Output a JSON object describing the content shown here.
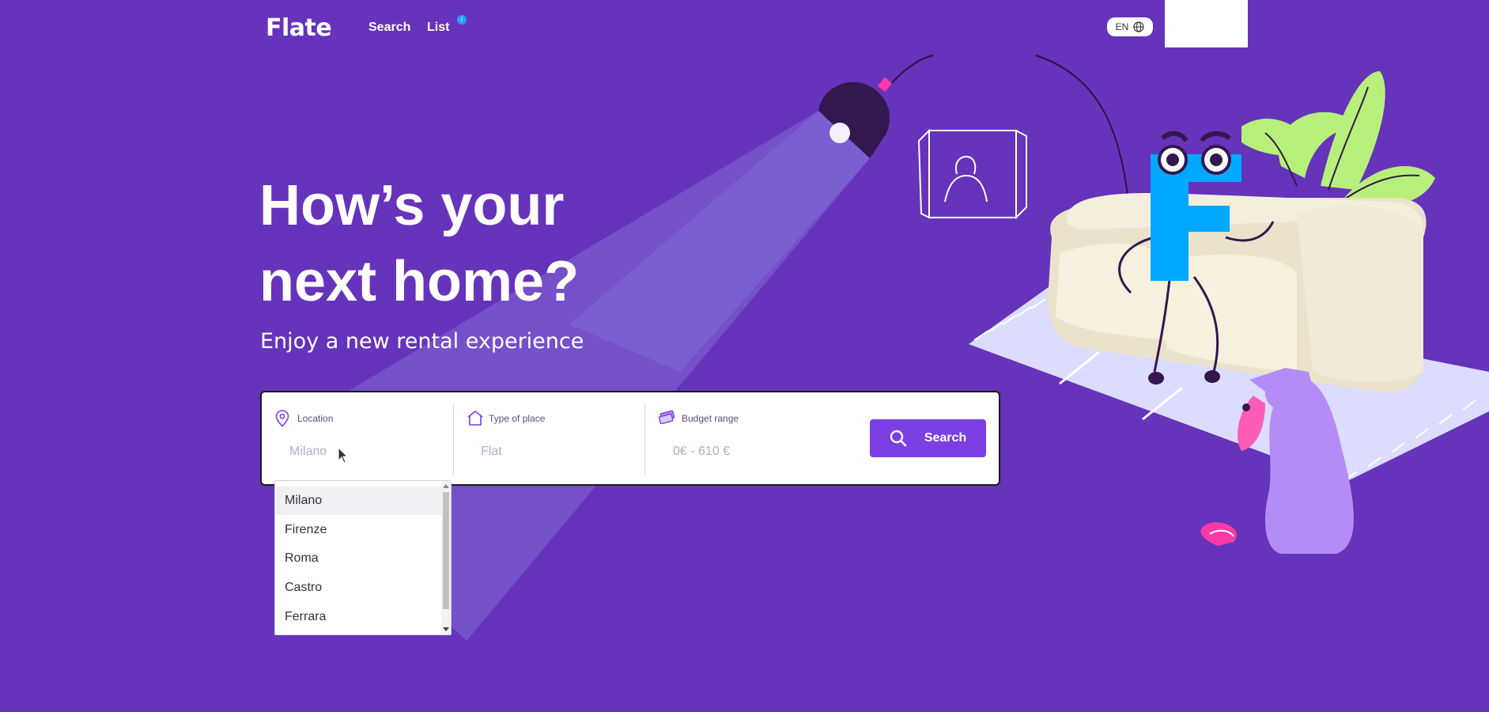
{
  "header": {
    "logo": "Flate",
    "nav": [
      {
        "label": "Search"
      },
      {
        "label": "List"
      }
    ],
    "info_badge": "i",
    "language": "EN"
  },
  "hero": {
    "title_line1": "How’s your",
    "title_line2": "next home?",
    "subtitle": "Enjoy a new rental experience"
  },
  "search": {
    "location": {
      "label": "Location",
      "value": "Milano",
      "icon": "location-pin-icon"
    },
    "type": {
      "label": "Type of place",
      "value": "Flat",
      "icon": "house-icon"
    },
    "budget": {
      "label": "Budget range",
      "value": "0€ - 610 €",
      "icon": "money-icon"
    },
    "button_label": "Search"
  },
  "dropdown": {
    "options": [
      "Milano",
      "Firenze",
      "Roma",
      "Castro",
      "Ferrara"
    ],
    "selected": "Milano"
  },
  "colors": {
    "background": "#6633bb",
    "accent": "#7b3fe4",
    "lamp_light": "#7a5fd0"
  }
}
